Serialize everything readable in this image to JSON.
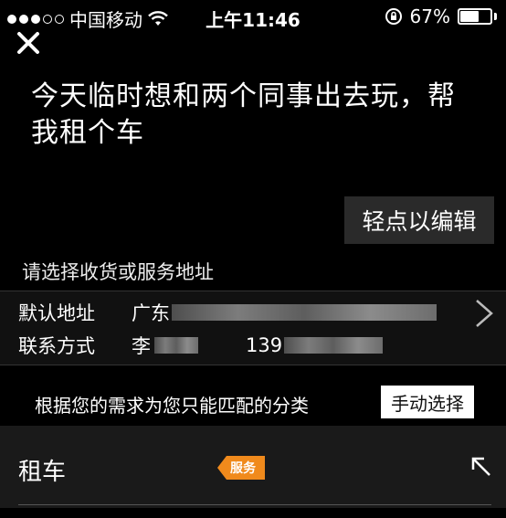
{
  "status_bar": {
    "carrier": "中国移动",
    "time": "上午11:46",
    "battery": "67%",
    "battery_level": 0.67
  },
  "prompt": {
    "text": "今天临时想和两个同事出去玩，帮我租个车",
    "edit_label": "轻点以编辑"
  },
  "address": {
    "header": "请选择收货或服务地址",
    "default_label": "默认地址",
    "default_value_visible": "广东",
    "contact_label": "联系方式",
    "contact_name_visible": "李",
    "contact_phone_visible": "139"
  },
  "match": {
    "text": "根据您的需求为您只能匹配的分类",
    "manual_label": "手动选择"
  },
  "category": {
    "name": "租车",
    "tag": "服务"
  },
  "colors": {
    "background": "#000000",
    "tag": "#f08a1c",
    "card": "#1a1a1a"
  }
}
